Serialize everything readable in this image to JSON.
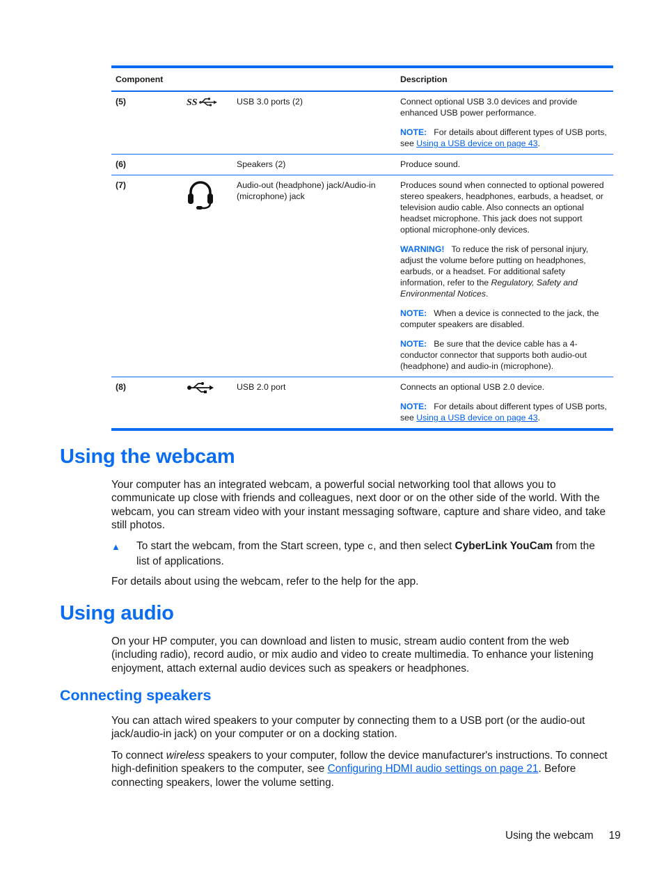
{
  "table": {
    "header": {
      "component": "Component",
      "description": "Description"
    },
    "rows": [
      {
        "num": "(5)",
        "icon": "usb-superspeed-icon",
        "name": "USB 3.0 ports (2)",
        "description": "Connect optional USB 3.0 devices and provide enhanced USB power performance.",
        "notes": [
          {
            "label": "NOTE:",
            "text": "For details about different types of USB ports, see ",
            "link": "Using a USB device on page 43",
            "after": "."
          }
        ]
      },
      {
        "num": "(6)",
        "icon": "",
        "name": "Speakers (2)",
        "description": "Produce sound.",
        "notes": []
      },
      {
        "num": "(7)",
        "icon": "headset-icon",
        "name": "Audio-out (headphone) jack/Audio-in (microphone) jack",
        "description": "Produces sound when connected to optional powered stereo speakers, headphones, earbuds, a headset, or television audio cable. Also connects an optional headset microphone. This jack does not support optional microphone-only devices.",
        "notes": [
          {
            "label": "WARNING!",
            "text": "To reduce the risk of personal injury, adjust the volume before putting on headphones, earbuds, or a headset. For additional safety information, refer to the ",
            "italic": "Regulatory, Safety and Environmental Notices",
            "after": "."
          },
          {
            "label": "NOTE:",
            "text": "When a device is connected to the jack, the computer speakers are disabled."
          },
          {
            "label": "NOTE:",
            "text": "Be sure that the device cable has a 4-conductor connector that supports both audio-out (headphone) and audio-in (microphone)."
          }
        ]
      },
      {
        "num": "(8)",
        "icon": "usb-icon",
        "name": "USB 2.0 port",
        "description": "Connects an optional USB 2.0 device.",
        "notes": [
          {
            "label": "NOTE:",
            "text": "For details about different types of USB ports, see ",
            "link": "Using a USB device on page 43",
            "after": "."
          }
        ]
      }
    ]
  },
  "webcam": {
    "heading": "Using the webcam",
    "intro": "Your computer has an integrated webcam, a powerful social networking tool that allows you to communicate up close with friends and colleagues, next door or on the other side of the world. With the webcam, you can stream video with your instant messaging software, capture and share video, and take still photos.",
    "step": {
      "bullet": "▲",
      "before": "To start the webcam, from the Start screen, type ",
      "code": "c",
      "middle": ", and then select ",
      "bold": "CyberLink YouCam",
      "after": " from the list of applications."
    },
    "details": "For details about using the webcam, refer to the help for the app."
  },
  "audio": {
    "heading": "Using audio",
    "intro": "On your HP computer, you can download and listen to music, stream audio content from the web (including radio), record audio, or mix audio and video to create multimedia. To enhance your listening enjoyment, attach external audio devices such as speakers or headphones."
  },
  "speakers": {
    "heading": "Connecting speakers",
    "para1": "You can attach wired speakers to your computer by connecting them to a USB port (or the audio-out jack/audio-in jack) on your computer or on a docking station.",
    "para2": {
      "before": "To connect ",
      "italic": "wireless",
      "middle": " speakers to your computer, follow the device manufacturer's instructions. To connect high-definition speakers to the computer, see ",
      "link": "Configuring HDMI audio settings on page 21",
      "after": ". Before connecting speakers, lower the volume setting."
    }
  },
  "footer": {
    "section": "Using the webcam",
    "page": "19"
  },
  "colors": {
    "accent": "#0a6cf0",
    "text": "#1a1a1a",
    "link": "#0061f2"
  }
}
